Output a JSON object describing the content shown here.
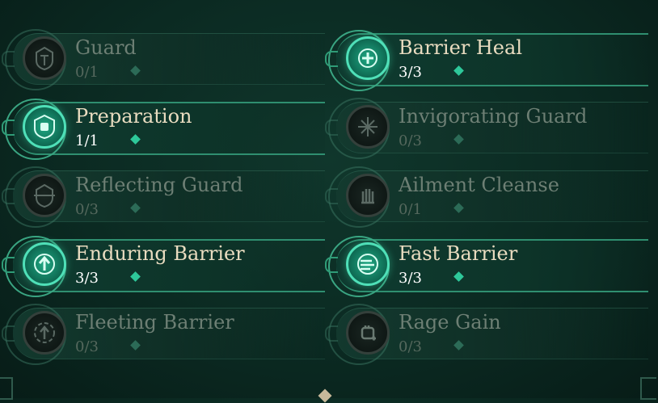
{
  "skills": [
    {
      "name": "Guard",
      "count": "0/1",
      "active": false,
      "icon": "helmet-icon"
    },
    {
      "name": "Barrier Heal",
      "count": "3/3",
      "active": true,
      "icon": "heal-cross-icon"
    },
    {
      "name": "Preparation",
      "count": "1/1",
      "active": true,
      "icon": "fist-shield-icon"
    },
    {
      "name": "Invigorating Guard",
      "count": "0/3",
      "active": false,
      "icon": "cross-burst-icon"
    },
    {
      "name": "Reflecting Guard",
      "count": "0/3",
      "active": false,
      "icon": "reflect-helmet-icon"
    },
    {
      "name": "Ailment Cleanse",
      "count": "0/1",
      "active": false,
      "icon": "hand-cleanse-icon"
    },
    {
      "name": "Enduring Barrier",
      "count": "3/3",
      "active": true,
      "icon": "arrow-up-icon"
    },
    {
      "name": "Fast Barrier",
      "count": "3/3",
      "active": true,
      "icon": "fast-barrier-icon"
    },
    {
      "name": "Fleeting Barrier",
      "count": "0/3",
      "active": false,
      "icon": "fleeting-arrow-icon"
    },
    {
      "name": "Rage Gain",
      "count": "0/3",
      "active": false,
      "icon": "rage-fist-icon"
    }
  ],
  "colors": {
    "active_accent": "#2ec89a",
    "inactive_text": "#6d7f74",
    "active_text": "#e9dcc0"
  }
}
